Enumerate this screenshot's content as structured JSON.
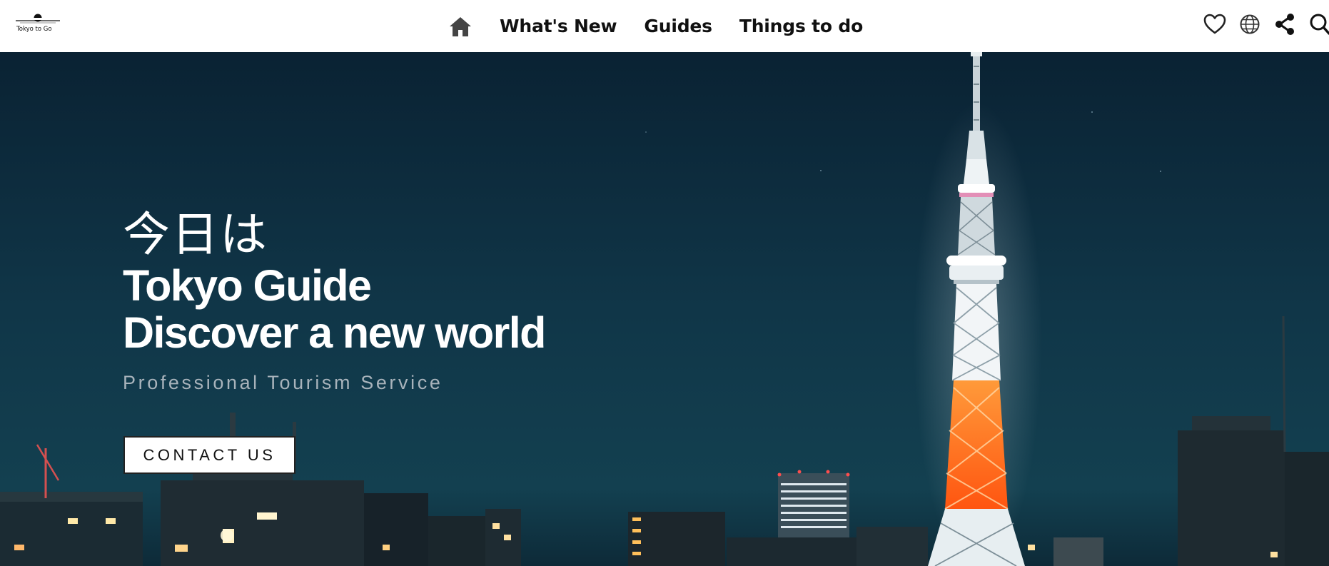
{
  "brand": {
    "logo_text": "Tokyo to Go"
  },
  "nav": {
    "home_icon": "home-icon",
    "links": [
      "What's New",
      "Guides",
      "Things to do"
    ]
  },
  "header_icons": [
    "heart-icon",
    "globe-icon",
    "share-icon",
    "search-icon"
  ],
  "hero": {
    "kanji": "今日は",
    "title_line_1": "Tokyo Guide",
    "title_line_2": "Discover a new world",
    "tagline": "Professional Tourism Service",
    "cta_label": "CONTACT US"
  },
  "colors": {
    "header_bg": "#ffffff",
    "nav_text": "#111111",
    "hero_sky": "#0f2e40",
    "tower_glow": "#ff6a1a",
    "tagline": "#a8b3bb"
  }
}
